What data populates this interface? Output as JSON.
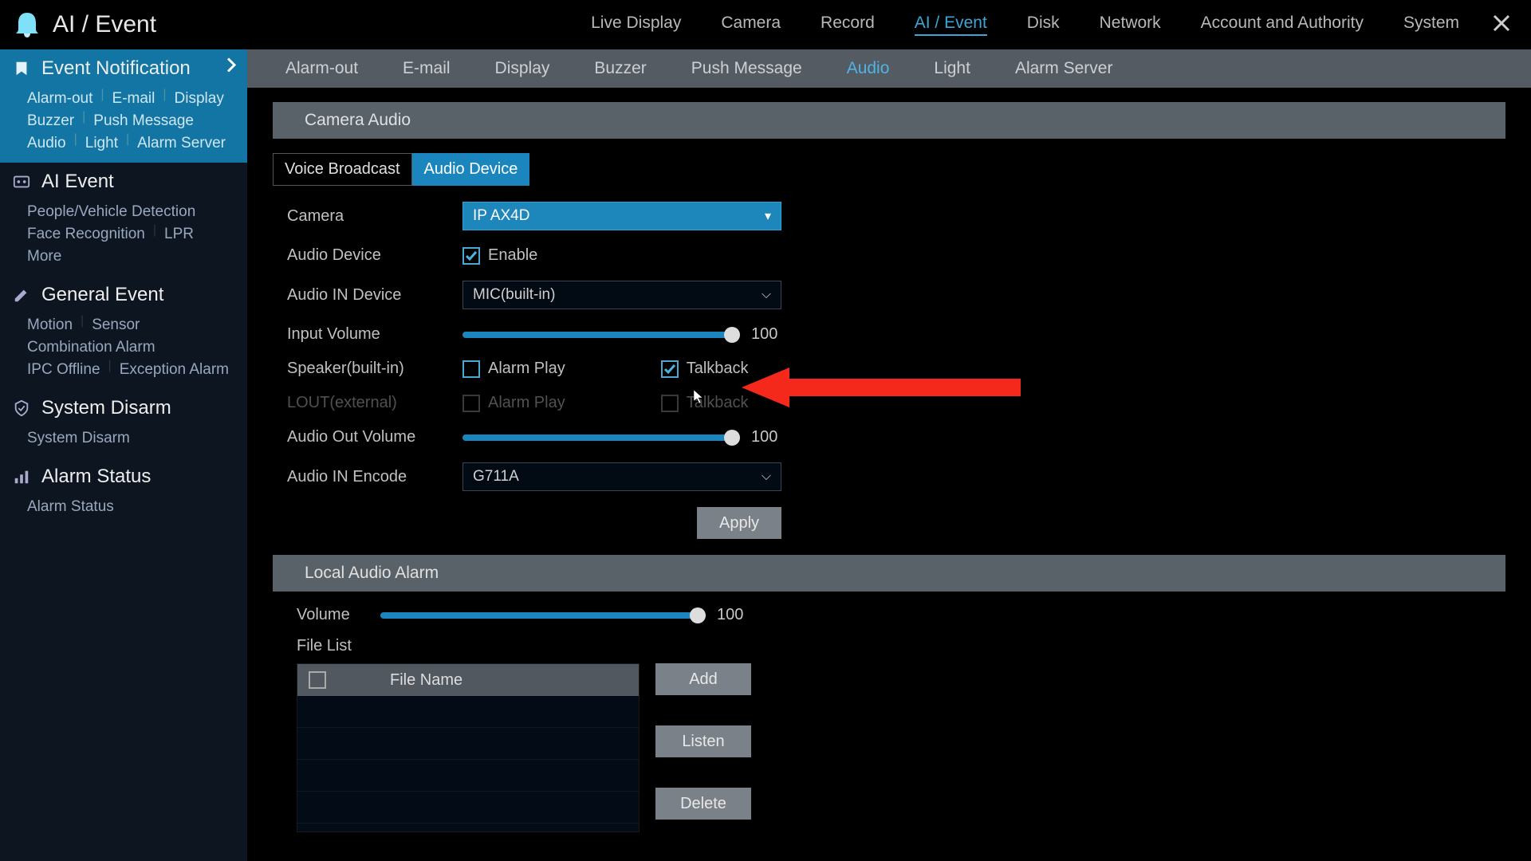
{
  "header": {
    "title": "AI / Event",
    "nav": [
      "Live Display",
      "Camera",
      "Record",
      "AI / Event",
      "Disk",
      "Network",
      "Account and Authority",
      "System"
    ],
    "active": "AI / Event"
  },
  "sidebar": [
    {
      "title": "Event Notification",
      "icon": "bookmark",
      "active": true,
      "chevron": true,
      "items": [
        "Alarm-out",
        "E-mail",
        "Display",
        "Buzzer",
        "Push Message",
        "Audio",
        "Light",
        "Alarm Server"
      ]
    },
    {
      "title": "AI Event",
      "icon": "ai",
      "items": [
        "People/Vehicle Detection",
        "Face Recognition",
        "LPR",
        "More"
      ]
    },
    {
      "title": "General Event",
      "icon": "pencil",
      "items": [
        "Motion",
        "Sensor",
        "Combination Alarm",
        "IPC Offline",
        "Exception Alarm"
      ]
    },
    {
      "title": "System Disarm",
      "icon": "shield",
      "items": [
        "System Disarm"
      ]
    },
    {
      "title": "Alarm Status",
      "icon": "bars",
      "items": [
        "Alarm Status"
      ]
    }
  ],
  "subtabs": {
    "items": [
      "Alarm-out",
      "E-mail",
      "Display",
      "Buzzer",
      "Push Message",
      "Audio",
      "Light",
      "Alarm Server"
    ],
    "active": "Audio"
  },
  "section1": {
    "title": "Camera Audio",
    "inner_tabs": [
      "Voice Broadcast",
      "Audio Device"
    ],
    "inner_active": "Audio Device",
    "camera_label": "Camera",
    "camera_value": "IP AX4D",
    "audio_device_label": "Audio Device",
    "enable_label": "Enable",
    "enable_checked": true,
    "audio_in_label": "Audio IN Device",
    "audio_in_value": "MIC(built-in)",
    "input_vol_label": "Input Volume",
    "input_vol_value": "100",
    "speaker_label": "Speaker(built-in)",
    "alarm_play_label": "Alarm Play",
    "talkback_label": "Talkback",
    "speaker_alarm_checked": false,
    "speaker_talkback_checked": true,
    "lout_label": "LOUT(external)",
    "lout_alarm_checked": false,
    "lout_talkback_checked": false,
    "audio_out_label": "Audio Out Volume",
    "audio_out_value": "100",
    "audio_encode_label": "Audio IN Encode",
    "audio_encode_value": "G711A",
    "apply": "Apply"
  },
  "section2": {
    "title": "Local Audio Alarm",
    "volume_label": "Volume",
    "volume_value": "100",
    "file_list_label": "File List",
    "file_name_header": "File Name",
    "add": "Add",
    "listen": "Listen",
    "delete": "Delete"
  }
}
